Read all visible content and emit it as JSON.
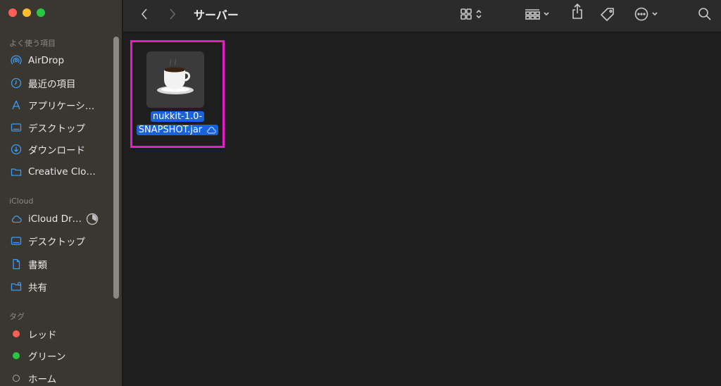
{
  "window": {
    "title": "サーバー"
  },
  "sidebar": {
    "favorites_title": "よく使う項目",
    "favorites": [
      {
        "label": "AirDrop",
        "icon": "airdrop-icon"
      },
      {
        "label": "最近の項目",
        "icon": "clock-icon"
      },
      {
        "label": "アプリケーシ…",
        "icon": "applications-icon"
      },
      {
        "label": "デスクトップ",
        "icon": "desktop-icon"
      },
      {
        "label": "ダウンロード",
        "icon": "download-icon"
      },
      {
        "label": "Creative Clo…",
        "icon": "folder-icon"
      }
    ],
    "icloud_title": "iCloud",
    "icloud": [
      {
        "label": "iCloud Dr…",
        "icon": "cloud-icon"
      },
      {
        "label": "デスクトップ",
        "icon": "desktop-icon"
      },
      {
        "label": "書類",
        "icon": "document-icon"
      },
      {
        "label": "共有",
        "icon": "shared-folder-icon"
      }
    ],
    "tags_title": "タグ",
    "tags": [
      {
        "label": "レッド",
        "color": "#fe5f57"
      },
      {
        "label": "グリーン",
        "color": "#28c840"
      },
      {
        "label": "ホーム",
        "color": ""
      }
    ]
  },
  "content": {
    "file": {
      "name_line1": "nukkit-1.0-",
      "name_line2": "SNAPSHOT.jar",
      "icon": "java-coffee-cup-icon"
    }
  },
  "colors": {
    "accent": "#1a62d8",
    "highlight_border": "#e41fc5",
    "sidebar_icon": "#3b9cf5"
  }
}
